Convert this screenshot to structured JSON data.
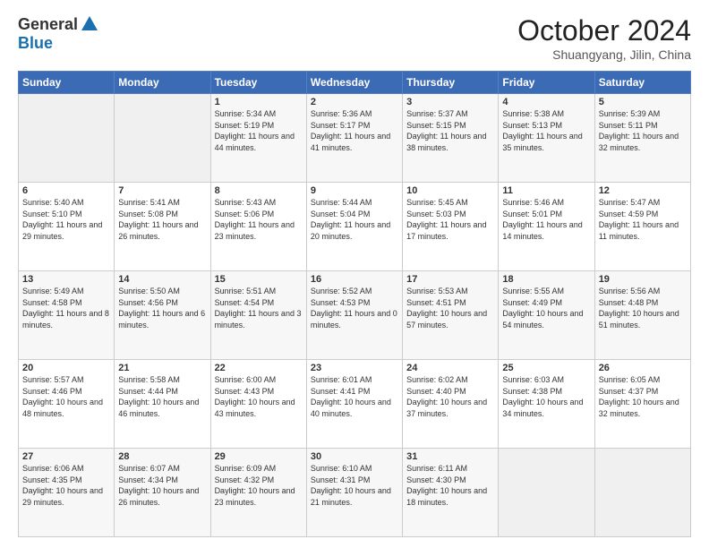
{
  "header": {
    "logo_general": "General",
    "logo_blue": "Blue",
    "month": "October 2024",
    "location": "Shuangyang, Jilin, China"
  },
  "days_of_week": [
    "Sunday",
    "Monday",
    "Tuesday",
    "Wednesday",
    "Thursday",
    "Friday",
    "Saturday"
  ],
  "weeks": [
    [
      {
        "day": "",
        "info": ""
      },
      {
        "day": "",
        "info": ""
      },
      {
        "day": "1",
        "info": "Sunrise: 5:34 AM\nSunset: 5:19 PM\nDaylight: 11 hours and 44 minutes."
      },
      {
        "day": "2",
        "info": "Sunrise: 5:36 AM\nSunset: 5:17 PM\nDaylight: 11 hours and 41 minutes."
      },
      {
        "day": "3",
        "info": "Sunrise: 5:37 AM\nSunset: 5:15 PM\nDaylight: 11 hours and 38 minutes."
      },
      {
        "day": "4",
        "info": "Sunrise: 5:38 AM\nSunset: 5:13 PM\nDaylight: 11 hours and 35 minutes."
      },
      {
        "day": "5",
        "info": "Sunrise: 5:39 AM\nSunset: 5:11 PM\nDaylight: 11 hours and 32 minutes."
      }
    ],
    [
      {
        "day": "6",
        "info": "Sunrise: 5:40 AM\nSunset: 5:10 PM\nDaylight: 11 hours and 29 minutes."
      },
      {
        "day": "7",
        "info": "Sunrise: 5:41 AM\nSunset: 5:08 PM\nDaylight: 11 hours and 26 minutes."
      },
      {
        "day": "8",
        "info": "Sunrise: 5:43 AM\nSunset: 5:06 PM\nDaylight: 11 hours and 23 minutes."
      },
      {
        "day": "9",
        "info": "Sunrise: 5:44 AM\nSunset: 5:04 PM\nDaylight: 11 hours and 20 minutes."
      },
      {
        "day": "10",
        "info": "Sunrise: 5:45 AM\nSunset: 5:03 PM\nDaylight: 11 hours and 17 minutes."
      },
      {
        "day": "11",
        "info": "Sunrise: 5:46 AM\nSunset: 5:01 PM\nDaylight: 11 hours and 14 minutes."
      },
      {
        "day": "12",
        "info": "Sunrise: 5:47 AM\nSunset: 4:59 PM\nDaylight: 11 hours and 11 minutes."
      }
    ],
    [
      {
        "day": "13",
        "info": "Sunrise: 5:49 AM\nSunset: 4:58 PM\nDaylight: 11 hours and 8 minutes."
      },
      {
        "day": "14",
        "info": "Sunrise: 5:50 AM\nSunset: 4:56 PM\nDaylight: 11 hours and 6 minutes."
      },
      {
        "day": "15",
        "info": "Sunrise: 5:51 AM\nSunset: 4:54 PM\nDaylight: 11 hours and 3 minutes."
      },
      {
        "day": "16",
        "info": "Sunrise: 5:52 AM\nSunset: 4:53 PM\nDaylight: 11 hours and 0 minutes."
      },
      {
        "day": "17",
        "info": "Sunrise: 5:53 AM\nSunset: 4:51 PM\nDaylight: 10 hours and 57 minutes."
      },
      {
        "day": "18",
        "info": "Sunrise: 5:55 AM\nSunset: 4:49 PM\nDaylight: 10 hours and 54 minutes."
      },
      {
        "day": "19",
        "info": "Sunrise: 5:56 AM\nSunset: 4:48 PM\nDaylight: 10 hours and 51 minutes."
      }
    ],
    [
      {
        "day": "20",
        "info": "Sunrise: 5:57 AM\nSunset: 4:46 PM\nDaylight: 10 hours and 48 minutes."
      },
      {
        "day": "21",
        "info": "Sunrise: 5:58 AM\nSunset: 4:44 PM\nDaylight: 10 hours and 46 minutes."
      },
      {
        "day": "22",
        "info": "Sunrise: 6:00 AM\nSunset: 4:43 PM\nDaylight: 10 hours and 43 minutes."
      },
      {
        "day": "23",
        "info": "Sunrise: 6:01 AM\nSunset: 4:41 PM\nDaylight: 10 hours and 40 minutes."
      },
      {
        "day": "24",
        "info": "Sunrise: 6:02 AM\nSunset: 4:40 PM\nDaylight: 10 hours and 37 minutes."
      },
      {
        "day": "25",
        "info": "Sunrise: 6:03 AM\nSunset: 4:38 PM\nDaylight: 10 hours and 34 minutes."
      },
      {
        "day": "26",
        "info": "Sunrise: 6:05 AM\nSunset: 4:37 PM\nDaylight: 10 hours and 32 minutes."
      }
    ],
    [
      {
        "day": "27",
        "info": "Sunrise: 6:06 AM\nSunset: 4:35 PM\nDaylight: 10 hours and 29 minutes."
      },
      {
        "day": "28",
        "info": "Sunrise: 6:07 AM\nSunset: 4:34 PM\nDaylight: 10 hours and 26 minutes."
      },
      {
        "day": "29",
        "info": "Sunrise: 6:09 AM\nSunset: 4:32 PM\nDaylight: 10 hours and 23 minutes."
      },
      {
        "day": "30",
        "info": "Sunrise: 6:10 AM\nSunset: 4:31 PM\nDaylight: 10 hours and 21 minutes."
      },
      {
        "day": "31",
        "info": "Sunrise: 6:11 AM\nSunset: 4:30 PM\nDaylight: 10 hours and 18 minutes."
      },
      {
        "day": "",
        "info": ""
      },
      {
        "day": "",
        "info": ""
      }
    ]
  ]
}
